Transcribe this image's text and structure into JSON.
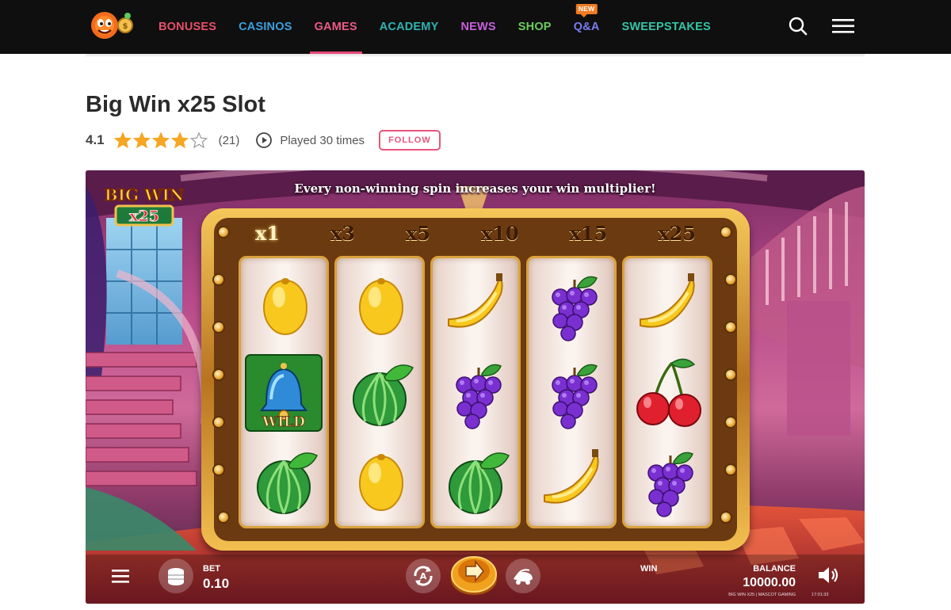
{
  "header": {
    "logo_icon": "mascot-logo-icon",
    "nav": [
      {
        "label": "BONUSES",
        "color": "#e8506a"
      },
      {
        "label": "CASINOS",
        "color": "#3aa0e0"
      },
      {
        "label": "GAMES",
        "color": "#ec5a86",
        "active": true
      },
      {
        "label": "ACADEMY",
        "color": "#2fb3b3"
      },
      {
        "label": "NEWS",
        "color": "#c95fe0"
      },
      {
        "label": "SHOP",
        "color": "#6ccf5a"
      },
      {
        "label": "Q&A",
        "color": "#7a7cf0",
        "badge": "NEW"
      },
      {
        "label": "SWEEPSTAKES",
        "color": "#33c7a8"
      }
    ],
    "search_icon": "search-icon",
    "menu_icon": "hamburger-menu-icon"
  },
  "page": {
    "title": "Big Win x25 Slot",
    "rating": "4.1",
    "rating_value": 4.1,
    "stars_max": 5,
    "review_count": "(21)",
    "played_text": "Played 30 times",
    "follow_label": "FOLLOW"
  },
  "game": {
    "banner_text": "Every non-winning spin increases your win multiplier!",
    "logo_text_top": "BIG WIN",
    "logo_text_bottom": "x25",
    "multipliers": [
      "x1",
      "x3",
      "x5",
      "x10",
      "x15",
      "x25"
    ],
    "active_multiplier": "x1",
    "reels": [
      [
        "lemon",
        "wild-bell",
        "watermelon"
      ],
      [
        "lemon",
        "watermelon",
        "lemon"
      ],
      [
        "banana",
        "grapes",
        "watermelon"
      ],
      [
        "grapes",
        "grapes",
        "banana"
      ],
      [
        "banana",
        "cherries",
        "grapes"
      ]
    ],
    "wild_label": "WILD",
    "controls": {
      "menu_icon": "hamburger-menu-icon",
      "bet_icon": "coin-stack-icon",
      "bet_label": "BET",
      "bet_value": "0.10",
      "autoplay_icon": "autoplay-icon",
      "spin_icon": "spin-arrow-icon",
      "turbo_icon": "turbo-icon",
      "win_label": "WIN",
      "balance_label": "BALANCE",
      "balance_value": "10000.00",
      "fine_print": "BIG WIN X25 | MASCOT GAMING",
      "clock": "17:01:33",
      "sound_icon": "speaker-icon"
    }
  },
  "colors": {
    "accent_pink": "#e8557e",
    "star": "#f5a623",
    "header_bg": "#0f0f0f"
  }
}
